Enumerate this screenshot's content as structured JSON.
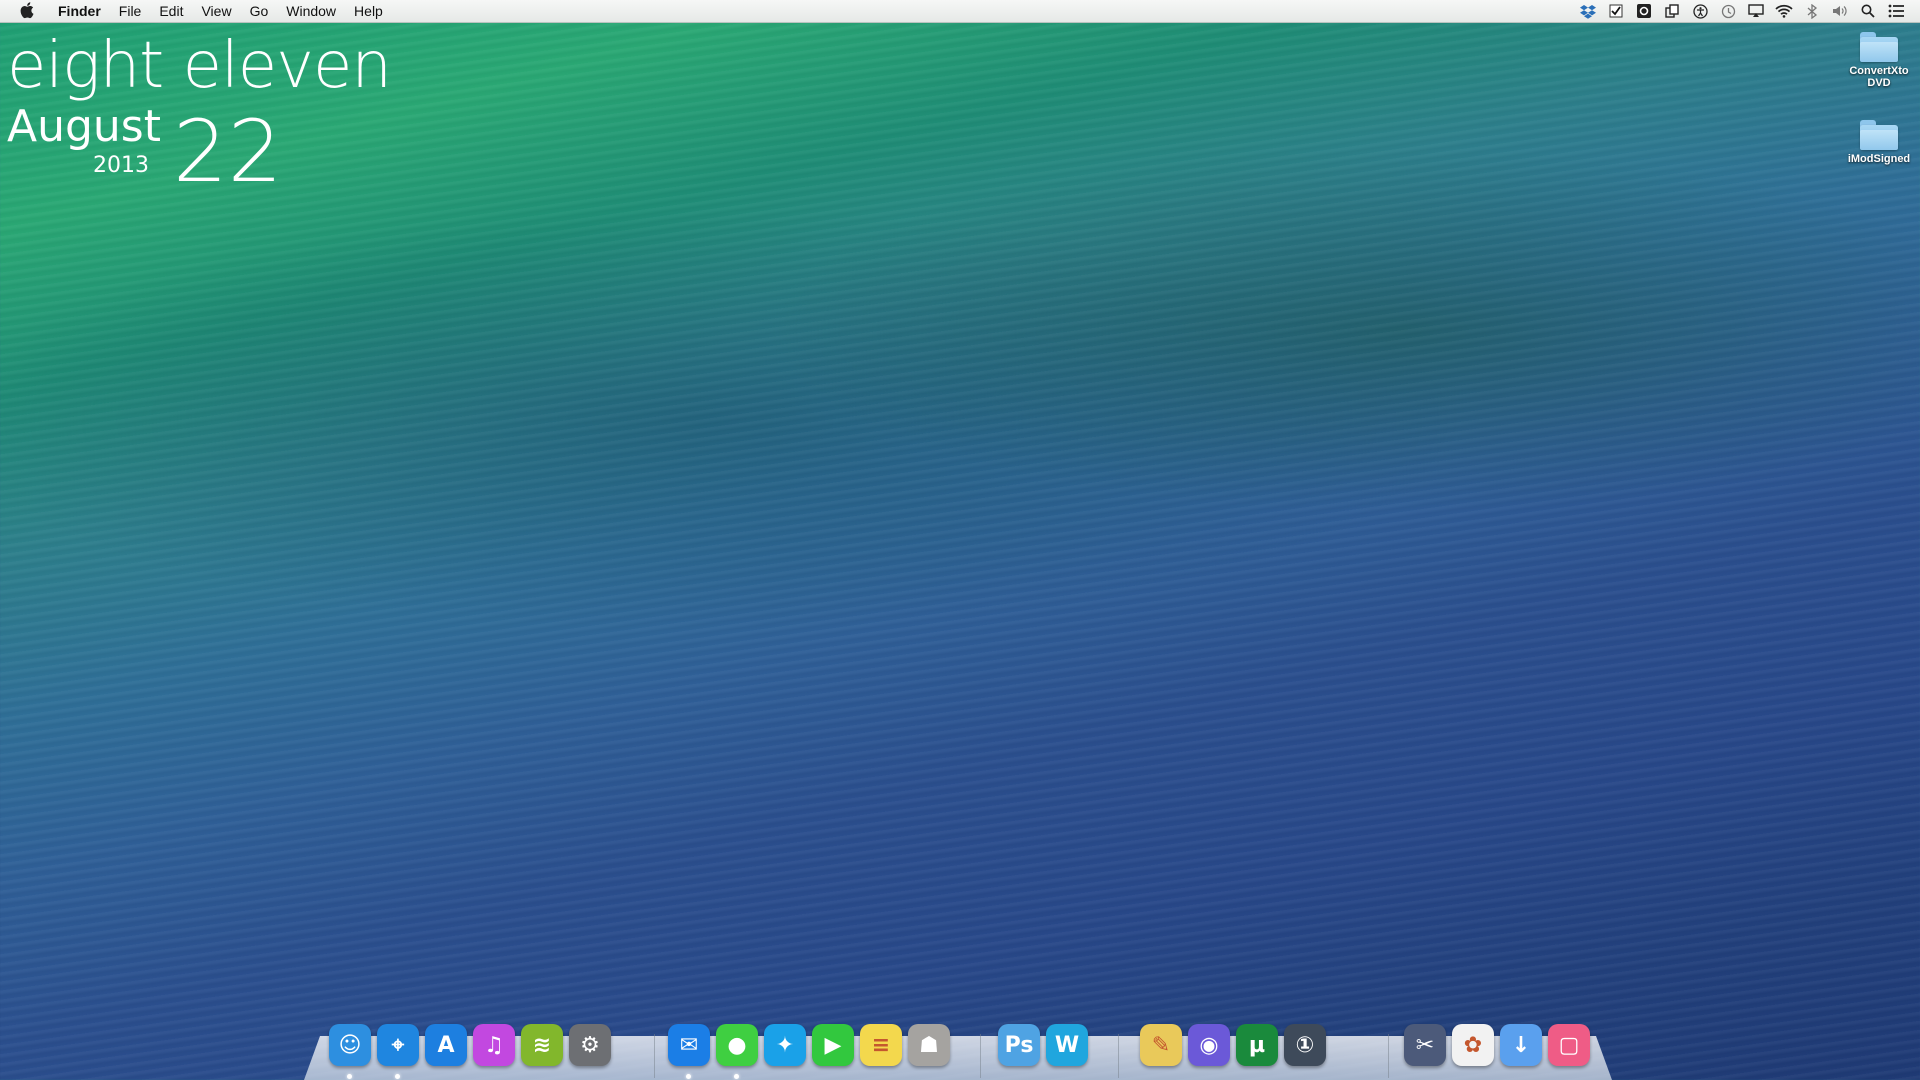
{
  "menubar": {
    "apple_icon": "apple-logo",
    "app_name": "Finder",
    "items": [
      "File",
      "Edit",
      "View",
      "Go",
      "Window",
      "Help"
    ],
    "status_icons": [
      "dropbox-icon",
      "checkbox-icon",
      "app-icon",
      "copy-icon",
      "accessibility-icon",
      "time-machine-icon",
      "airplay-icon",
      "wifi-icon",
      "bluetooth-icon",
      "volume-icon",
      "spotlight-icon",
      "notification-center-icon"
    ]
  },
  "clock": {
    "time": "eight eleven",
    "month": "August",
    "year": "2013",
    "day": "22"
  },
  "desktop": {
    "icons": [
      {
        "label_line1": "ConvertXto",
        "label_line2": "DVD",
        "icon": "folder-icon"
      },
      {
        "label_line1": "iModSigned",
        "label_line2": "",
        "icon": "folder-icon"
      }
    ]
  },
  "dock": {
    "apps": [
      {
        "name": "Finder",
        "icon": "finder-icon",
        "color": "#2d8fe0",
        "glyph": "☺"
      },
      {
        "name": "Safari",
        "icon": "safari-icon",
        "color": "#1f86e0",
        "glyph": "⌖"
      },
      {
        "name": "App Store",
        "icon": "app-store-icon",
        "color": "#1d7fe0",
        "glyph": "A"
      },
      {
        "name": "iTunes",
        "icon": "itunes-icon",
        "color": "#c248e0",
        "glyph": "♫"
      },
      {
        "name": "Spotify",
        "icon": "spotify-icon",
        "color": "#82b72c",
        "glyph": "≋"
      },
      {
        "name": "System Preferences",
        "icon": "system-preferences-icon",
        "color": "#6d6f73",
        "glyph": "⚙"
      },
      {
        "name": "Mail",
        "icon": "mail-icon",
        "color": "#1b7ee6",
        "glyph": "✉"
      },
      {
        "name": "Messages",
        "icon": "messages-icon",
        "color": "#3fcf41",
        "glyph": "●"
      },
      {
        "name": "Twitter",
        "icon": "twitter-icon",
        "color": "#1aa1e8",
        "glyph": "✦"
      },
      {
        "name": "FaceTime",
        "icon": "facetime-icon",
        "color": "#32c83e",
        "glyph": "▶"
      },
      {
        "name": "Notes",
        "icon": "notes-icon",
        "color": "#f3d84d",
        "glyph": "≡"
      },
      {
        "name": "Contacts",
        "icon": "contacts-icon",
        "color": "#a5a3a0",
        "glyph": "☗"
      },
      {
        "name": "Photoshop",
        "icon": "photoshop-icon",
        "color": "#4fa3e3",
        "glyph": "Ps"
      },
      {
        "name": "Word",
        "icon": "word-icon",
        "color": "#20a6de",
        "glyph": "W"
      },
      {
        "name": "Preview",
        "icon": "preview-icon",
        "color": "#e9c95a",
        "glyph": "✎"
      },
      {
        "name": "Colors",
        "icon": "colors-icon",
        "color": "#6b59d8",
        "glyph": "◉"
      },
      {
        "name": "uTorrent",
        "icon": "utorrent-icon",
        "color": "#1a8a3c",
        "glyph": "µ"
      },
      {
        "name": "1Password",
        "icon": "1password-icon",
        "color": "#3e4a5a",
        "glyph": "①"
      },
      {
        "name": "Scissors",
        "icon": "scissors-icon",
        "color": "#4c5a7a",
        "glyph": "✂"
      },
      {
        "name": "Photos",
        "icon": "photos-icon",
        "color": "#f2f2f2",
        "glyph": "✿"
      },
      {
        "name": "Downloads",
        "icon": "downloads-icon",
        "color": "#5aa0ee",
        "glyph": "↓"
      },
      {
        "name": "Trash",
        "icon": "trash-icon",
        "color": "#ef5c86",
        "glyph": "▢"
      }
    ],
    "running_apps": [
      "Finder",
      "Safari",
      "Mail",
      "Messages"
    ]
  },
  "colors": {
    "menubar_bg": "#eef0ee",
    "clock_text": "#ffffff",
    "wallpaper_top": "#1f9f74",
    "wallpaper_bottom": "#1f3a75"
  }
}
